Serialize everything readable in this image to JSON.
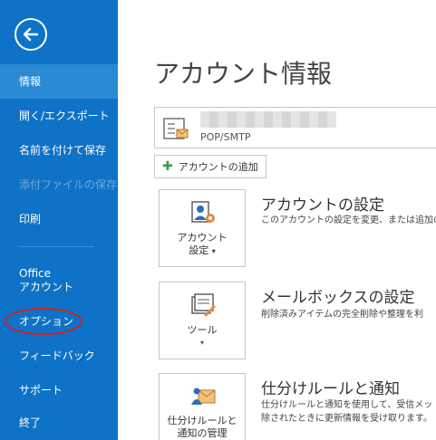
{
  "sidebar": {
    "back_icon": "back-arrow-icon",
    "items": [
      {
        "label": "情報",
        "state": "active"
      },
      {
        "label": "開く/エクスポート"
      },
      {
        "label": "名前を付けて保存"
      },
      {
        "label": "添付ファイルの保存",
        "state": "disabled"
      },
      {
        "label": "印刷"
      },
      {
        "label": "Office\nアカウント"
      },
      {
        "label": "オプション",
        "annotation": "circled-red"
      },
      {
        "label": "フィードバック"
      },
      {
        "label": "サポート"
      },
      {
        "label": "終了"
      }
    ]
  },
  "main": {
    "title": "アカウント情報",
    "account": {
      "type": "POP/SMTP",
      "icon": "account-mailbox-icon"
    },
    "add_account_label": "アカウントの追加",
    "sections": [
      {
        "tile_label_1": "アカウント",
        "tile_label_2": "設定",
        "icon": "account-settings-icon",
        "heading": "アカウントの設定",
        "desc_1": "このアカウントの設定を変更、または追加の"
      },
      {
        "tile_label_1": "ツール",
        "icon": "tools-icon",
        "heading": "メールボックスの設定",
        "desc_1": "削除済みアイテムの完全削除や整理を利"
      },
      {
        "tile_label_1": "仕分けルールと",
        "tile_label_2": "通知の管理",
        "icon": "rules-alerts-icon",
        "heading": "仕分けルールと通知",
        "desc_1": "仕分けルールと通知を使用して、受信メッ",
        "desc_2": "除されたときに更新情報を受け取ります。"
      }
    ]
  },
  "colors": {
    "sidebar_bg": "#0e72c6",
    "sidebar_active": "#2a8ad4",
    "annotation_red": "#d02028"
  }
}
